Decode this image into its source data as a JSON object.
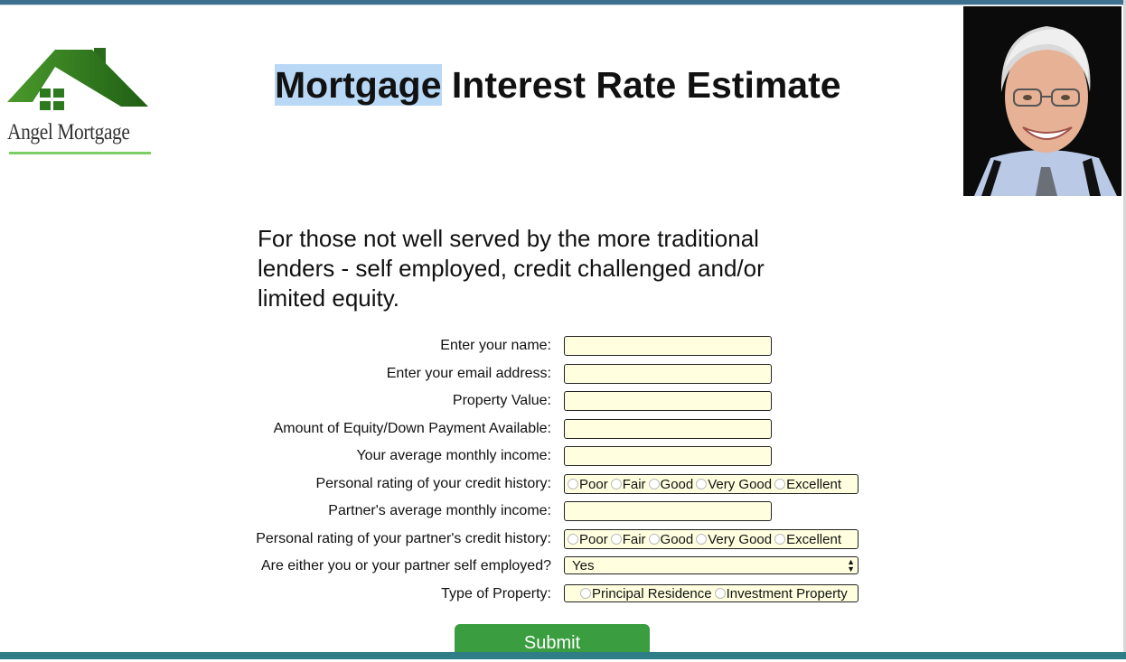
{
  "header": {
    "logo_text": "Angel Mortgage",
    "title_highlight": "Mortgage",
    "title_rest": " Interest Rate Estimate"
  },
  "intro": {
    "tagline": "For those not well served by the more traditional lenders - self employed, credit challenged and/or limited equity."
  },
  "form": {
    "name_label": "Enter your name:",
    "email_label": "Enter your email address:",
    "property_value_label": "Property Value:",
    "equity_label": "Amount of Equity/Down Payment Available:",
    "income_label": "Your average monthly income:",
    "credit_label": "Personal rating of your credit history:",
    "partner_income_label": "Partner's average monthly income:",
    "partner_credit_label": "Personal rating of your partner's credit history:",
    "self_employed_label": "Are either you or your partner self employed?",
    "self_employed_value": "Yes",
    "property_type_label": "Type of Property:",
    "credit_options": [
      "Poor",
      "Fair",
      "Good",
      "Very Good",
      "Excellent"
    ],
    "property_options": [
      "Principal Residence",
      "Investment Property"
    ],
    "submit_label": "Submit"
  },
  "colors": {
    "logo_green": "#2e7d1f",
    "input_background": "#ffffe0",
    "submit_green": "#3a9d3f",
    "title_highlight": "#b9d8f5",
    "bottom_bar": "#2f7d86"
  }
}
